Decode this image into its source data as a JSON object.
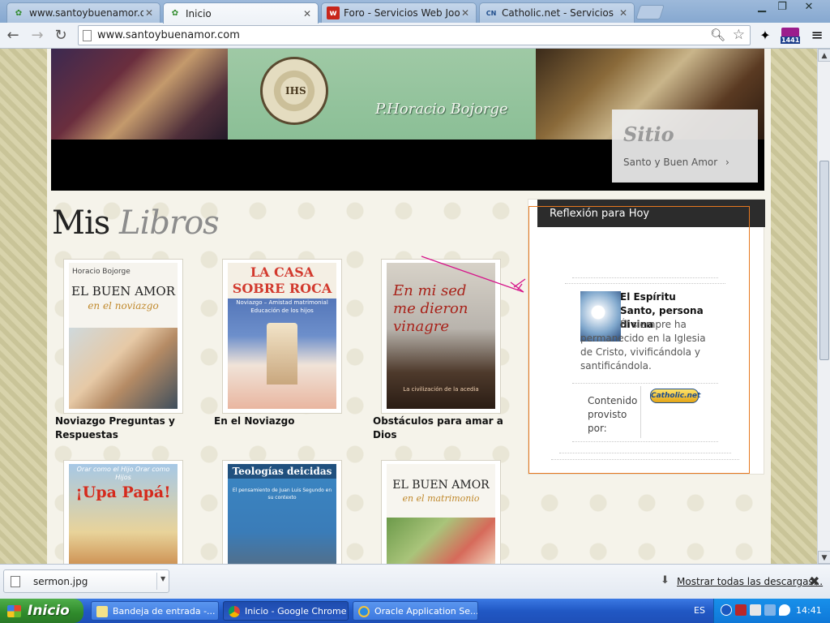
{
  "browser": {
    "tabs": [
      {
        "label": "www.santoybuenamor.com -",
        "favicon": "santoybuenamor-favicon",
        "active": false
      },
      {
        "label": "Inicio",
        "favicon": "santoybuenamor-favicon",
        "active": true
      },
      {
        "label": "Foro - Servicios Web Joomla",
        "favicon": "joomla-favicon",
        "active": false
      },
      {
        "label": "Catholic.net - Servicios",
        "favicon": "catholic-net-favicon",
        "active": false
      }
    ],
    "url": "www.santoybuenamor.com",
    "extension_badge": "1441"
  },
  "banner": {
    "signature": "P.Horacio Bojorge",
    "sitio_title": "Sitio",
    "sitio_subtitle": "Santo y Buen Amor",
    "sitio_chevron": "›"
  },
  "heading": {
    "main": "Mis",
    "accent": "Libros"
  },
  "books": [
    {
      "title": "Noviazgo Preguntas y Respuestas",
      "cover_author": "Horacio Bojorge",
      "cover_title": "EL BUEN AMOR",
      "cover_subtitle": "en el noviazgo"
    },
    {
      "title": "En el Noviazgo",
      "cover_title": "LA CASA SOBRE ROCA",
      "cover_subtitle": "Noviazgo – Amistad matrimonial Educación de los hijos"
    },
    {
      "title": "Obstáculos para amar a Dios",
      "cover_title": "En mi sed me dieron vinagre",
      "cover_subtitle": "La civilización de la acedia"
    },
    {
      "title": "",
      "cover_top": "Orar como el Hijo Orar como Hijos",
      "cover_title": "¡Upa Papá!"
    },
    {
      "title": "",
      "cover_title": "Teologías deicidas",
      "cover_subtitle": "El pensamiento de Juan Luis Segundo en su contexto"
    },
    {
      "title": "",
      "cover_title": "EL BUEN AMOR",
      "cover_subtitle": "en el matrimonio"
    }
  ],
  "reflexion": {
    "header": "Reflexión para Hoy",
    "article_title": "El Espíritu Santo, persona divina",
    "article_body_1": "Él siempre ha",
    "article_body_2": "permanecido en la Iglesia de Cristo, vivificándola y santificándola.",
    "provided_by": "Contenido provisto por:",
    "provider_logo": "Catholic.net"
  },
  "downloads": {
    "file": "sermon.jpg",
    "show_all": "Mostrar todas las descargas..."
  },
  "taskbar": {
    "start": "Inicio",
    "tasks": [
      {
        "label": "Bandeja de entrada -...",
        "active": false
      },
      {
        "label": "Inicio - Google Chrome",
        "active": true
      },
      {
        "label": "Oracle Application Se...",
        "active": false
      }
    ],
    "language": "ES",
    "clock": "14:41"
  },
  "colors": {
    "widget_outline": "#e6781f",
    "widget_header": "#2c2c2c",
    "annotation_arrow": "#d6138a",
    "taskbar_blue": "#2158c4",
    "start_green": "#2f8a2b"
  }
}
